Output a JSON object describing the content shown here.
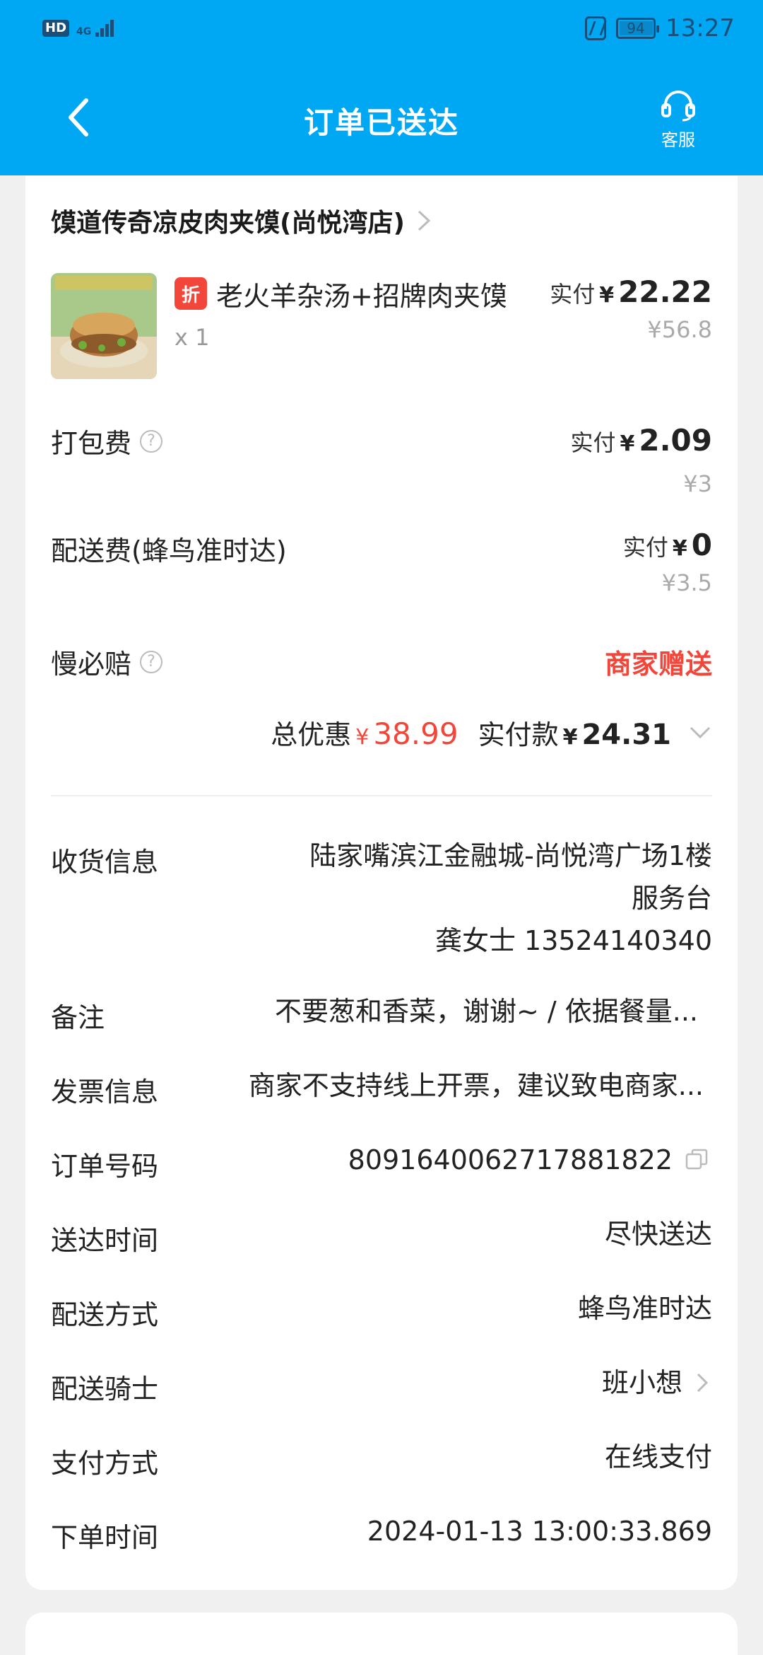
{
  "status_bar": {
    "hd": "HD",
    "network": "4G",
    "battery": "94",
    "battery_level_percent": 94,
    "time": "13:27"
  },
  "header": {
    "title": "订单已送达",
    "service_label": "客服"
  },
  "shop": {
    "name": "馍道传奇凉皮肉夹馍(尚悦湾店)"
  },
  "item": {
    "badge": "折",
    "name": "老火羊杂汤+招牌肉夹馍",
    "qty": "x 1",
    "paid_label": "实付",
    "currency": "¥",
    "paid": "22.22",
    "original": "¥56.8"
  },
  "fees": {
    "packing": {
      "label": "打包费",
      "paid_label": "实付",
      "currency": "¥",
      "paid": "2.09",
      "original": "¥3"
    },
    "delivery": {
      "label": "配送费(蜂鸟准时达)",
      "paid_label": "实付",
      "currency": "¥",
      "paid": "0",
      "original": "¥3.5"
    },
    "slow_compensation": {
      "label": "慢必赔",
      "value": "商家赠送"
    }
  },
  "totals": {
    "discount_label": "总优惠",
    "currency": "¥",
    "discount": "38.99",
    "paid_label": "实付款",
    "paid": "24.31"
  },
  "info": {
    "address": {
      "label": "收货信息",
      "line1": "陆家嘴滨江金融城-尚悦湾广场1楼",
      "line2": "服务台",
      "contact": "龚女士 13524140340"
    },
    "remark": {
      "label": "备注",
      "value": "不要葱和香菜，谢谢~ / 依据餐量..."
    },
    "invoice": {
      "label": "发票信息",
      "value": "商家不支持线上开票，建议致电商家..."
    },
    "order_no": {
      "label": "订单号码",
      "value": "8091640062717881822"
    },
    "delivery_time": {
      "label": "送达时间",
      "value": "尽快送达"
    },
    "delivery_method": {
      "label": "配送方式",
      "value": "蜂鸟准时达"
    },
    "rider": {
      "label": "配送骑士",
      "value": "班小想"
    },
    "payment": {
      "label": "支付方式",
      "value": "在线支付"
    },
    "order_time": {
      "label": "下单时间",
      "value": "2024-01-13 13:00:33.869"
    }
  },
  "colors": {
    "header_bg": "#00a8f3",
    "accent_red": "#f2463a",
    "muted": "#aaaaaa"
  }
}
